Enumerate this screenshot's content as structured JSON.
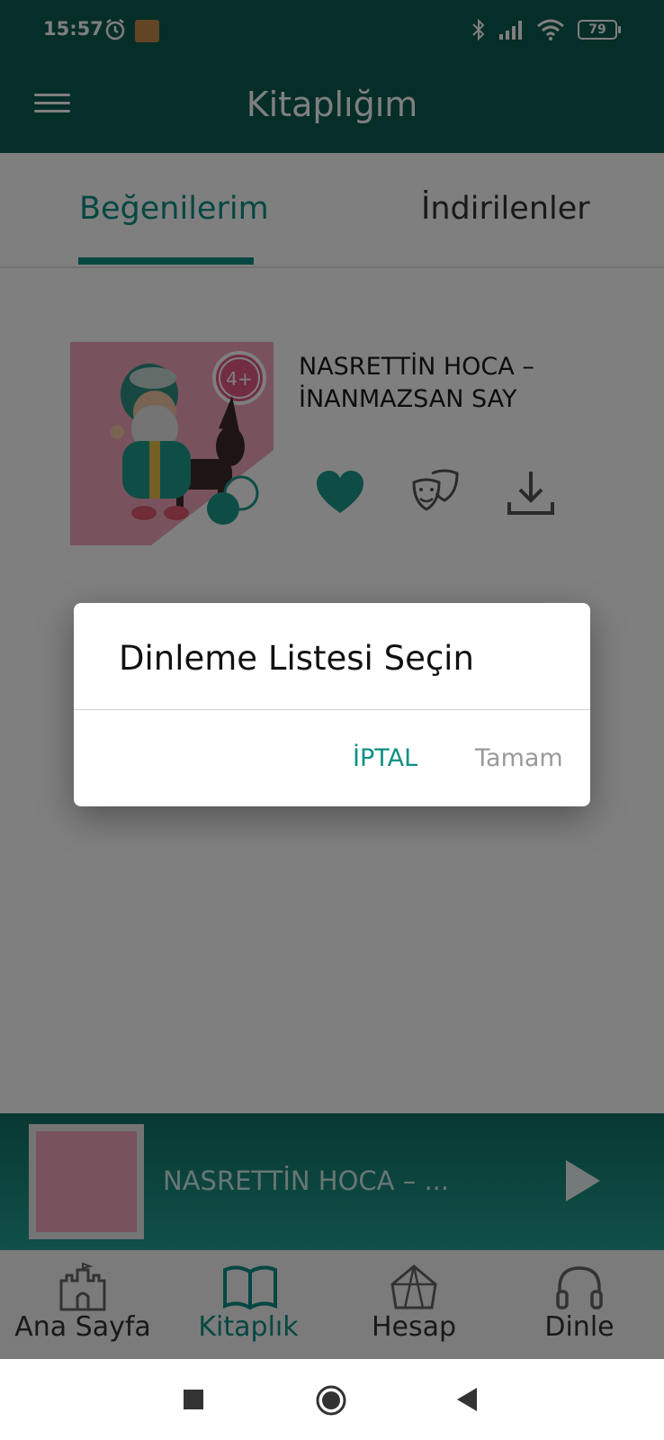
{
  "status_bar": {
    "time": "15:57",
    "battery": "79"
  },
  "app_bar": {
    "title": "Kitaplığım"
  },
  "tabs": [
    {
      "label": "Beğenilerim",
      "active": true
    },
    {
      "label": "İndirilenler",
      "active": false
    }
  ],
  "book": {
    "title_line1": "NASRETTİN HOCA –",
    "title_line2": "İNANMAZSAN SAY",
    "age_badge": "4+"
  },
  "dialog": {
    "title": "Dinleme Listesi Seçin",
    "cancel_label": "İPTAL",
    "ok_label": "Tamam"
  },
  "player": {
    "title": "NASRETTİN HOCA – ..."
  },
  "bottom_nav": [
    {
      "label": "Ana Sayfa",
      "icon": "castle-icon"
    },
    {
      "label": "Kitaplık",
      "icon": "book-icon",
      "active": true
    },
    {
      "label": "Hesap",
      "icon": "tent-icon"
    },
    {
      "label": "Dinle",
      "icon": "headphones-icon"
    }
  ],
  "colors": {
    "primary": "#0d5c50",
    "accent": "#0d8f84",
    "heart": "#1d9a8c"
  }
}
